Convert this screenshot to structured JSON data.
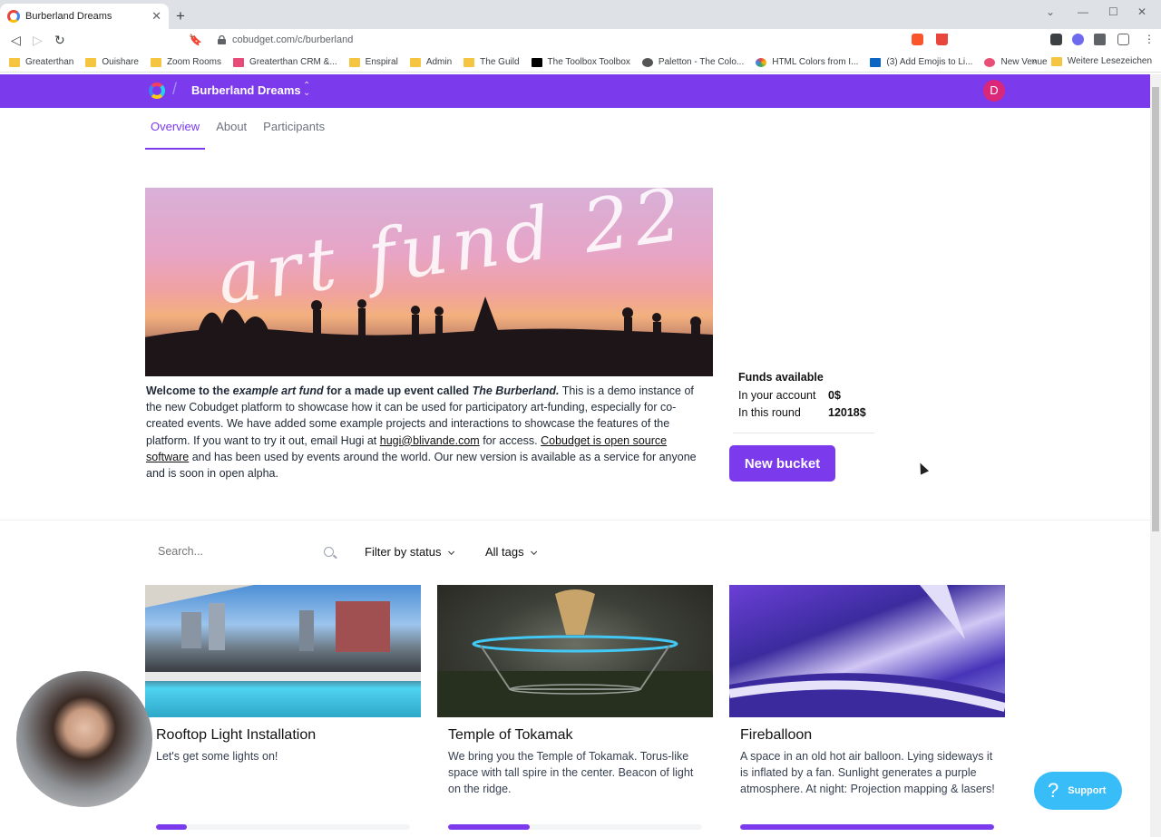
{
  "browser": {
    "tab_title": "Burberland Dreams",
    "url": "cobudget.com/c/burberland",
    "bookmarks": [
      "Greaterthan",
      "Ouishare",
      "Zoom Rooms",
      "Greaterthan CRM &...",
      "Enspiral",
      "Admin",
      "The Guild",
      "The Toolbox Toolbox",
      "Paletton - The Colo...",
      "HTML Colors from I...",
      "(3) Add Emojis to Li...",
      "New Venue"
    ],
    "bookmarks_overflow": "»",
    "other_bookmarks": "Weitere Lesezeichen"
  },
  "header": {
    "group_name": "Burberland Dreams",
    "avatar_letter": "D",
    "accent_color": "#7c3aed"
  },
  "tabs": [
    {
      "label": "Overview",
      "active": true
    },
    {
      "label": "About",
      "active": false
    },
    {
      "label": "Participants",
      "active": false
    }
  ],
  "hero": {
    "script_text": "art fund 22"
  },
  "intro": {
    "p1": "Welcome to the ",
    "p2": "example art fund",
    "p3": " for a made up event called ",
    "p4": "The Burberland.",
    "p5": " This is a demo instance of the new Cobudget platform to showcase how it can be used for participatory art-funding, especially for co-created events. We have added some example projects and interactions to showcase the features of the platform. If you want to try it out, email Hugi at ",
    "email": "hugi@blivande.com",
    "p6": " for access. ",
    "oss_link": "Cobudget is open source software",
    "p7": " and has been used by events around the world. Our new version is available as a service for anyone and is soon in open alpha."
  },
  "funds": {
    "title": "Funds available",
    "account_label": "In your account",
    "account_value": "0$",
    "round_label": "In this round",
    "round_value": "12018$"
  },
  "new_bucket_label": "New bucket",
  "filters": {
    "search_placeholder": "Search...",
    "status_label": "Filter by status",
    "tags_label": "All tags"
  },
  "buckets": [
    {
      "title": "Rooftop Light Installation",
      "description": "Let's get some lights on!",
      "progress": 0.12
    },
    {
      "title": "Temple of Tokamak",
      "description": "We bring you the Temple of Tokamak. Torus-like space with tall spire in the center. Beacon of light on the ridge.",
      "progress": 0.32
    },
    {
      "title": "Fireballoon",
      "description": "A space in an old hot air balloon. Lying sideways it is inflated by a fan. Sunlight generates a purple atmosphere. At night: Projection mapping & lasers!",
      "progress": 1.0
    }
  ],
  "support_label": "Support",
  "support_icon": "?"
}
